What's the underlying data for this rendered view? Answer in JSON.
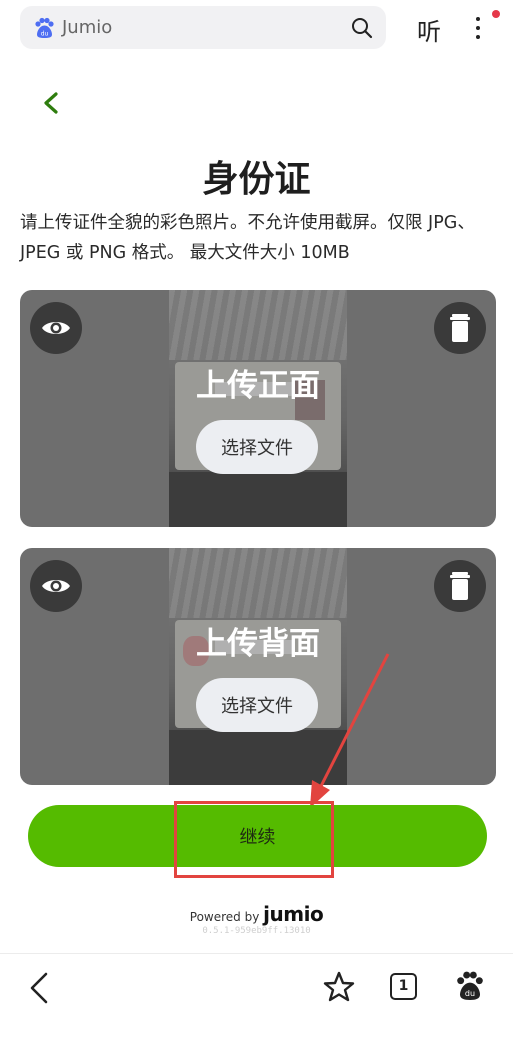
{
  "browser": {
    "search_text": "Jumio",
    "listen_label": "听",
    "accent_dot_color": "#e5384a"
  },
  "page": {
    "title": "身份证",
    "description": "请上传证件全貌的彩色照片。不允许使用截屏。仅限 JPG、JPEG 或 PNG 格式。 最大文件大小 10MB"
  },
  "front_card": {
    "heading": "上传正面",
    "choose_label": "选择文件"
  },
  "back_card": {
    "heading": "上传背面",
    "choose_label": "选择文件"
  },
  "continue": {
    "label": "继续",
    "color": "#55bb00"
  },
  "footer": {
    "powered_by": "Powered by",
    "brand": "jumio",
    "version": "0.5.1-959eb9ff.13010"
  },
  "bottom_bar": {
    "tab_count": "1",
    "icons": [
      "back-icon",
      "star-icon",
      "tabs-icon",
      "paw-icon"
    ]
  }
}
